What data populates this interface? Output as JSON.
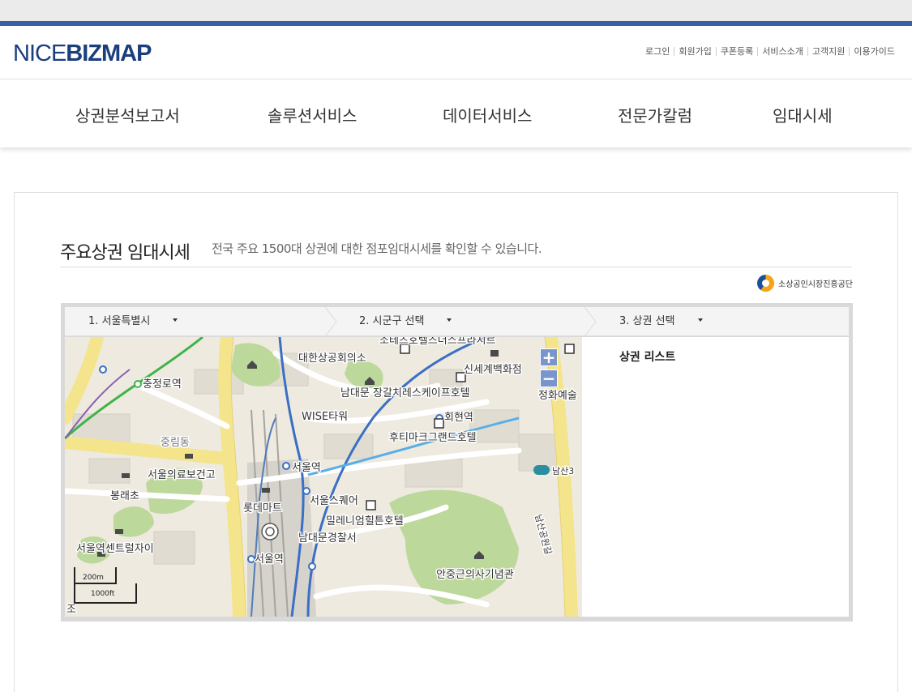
{
  "header": {
    "logo_prefix": "NICE",
    "logo_bold": "BIZMAP",
    "util_links": [
      "로그인",
      "회원가입",
      "쿠폰등록",
      "서비스소개",
      "고객지원",
      "이용가이드"
    ]
  },
  "gnb": [
    "상권분석보고서",
    "솔루션서비스",
    "데이터서비스",
    "전문가칼럼",
    "임대시세"
  ],
  "page": {
    "title": "주요상권 임대시세",
    "subtitle": "전국 주요 1500대 상권에 대한 점포임대시세를 확인할 수 있습니다.",
    "agency": "소상공인시장진흥공단"
  },
  "selectors": {
    "sido": "1. 서울특별시",
    "sigungu": "2. 시군구 선택",
    "sangwon": "3. 상권 선택"
  },
  "list": {
    "title": "상권 리스트"
  },
  "map": {
    "zoom_in": "+",
    "zoom_out": "−",
    "scale_metric": "200m",
    "scale_imperial": "1000ft",
    "labels": {
      "l1": "소테츠호텔즈더스프라지르",
      "l2": "대한상공회의소",
      "l3": "신세계백화점",
      "l4": "정화예술",
      "l5": "충정로역",
      "l6": "남대문 장갈치레스케이프호텔",
      "l7": "WISE타워",
      "l8": "회현역",
      "l9": "후티마크그랜드호텔",
      "l10": "중림동",
      "l11": "서울역",
      "l12": "남산3",
      "l13": "서울의료보건고",
      "l14": "봉래초",
      "l15": "서울스퀘어",
      "l16": "롯데마트",
      "l17": "밀레니엄힐튼호텔",
      "l18": "남대문경찰서",
      "l19": "서울역센트럴자이",
      "l20": "서울역",
      "l21": "안중근의사기념관",
      "l22": "남산공원길",
      "l23": "조"
    }
  },
  "colors": {
    "brand_navy": "#1b3e7d",
    "stripe": "#3b5fa3",
    "zoom_button": "#7a95cc",
    "road_yellow": "#f4e48c",
    "subway_blue": "#3a6fc4",
    "subway_green": "#3eb34a",
    "park_green": "#b9d79a"
  }
}
